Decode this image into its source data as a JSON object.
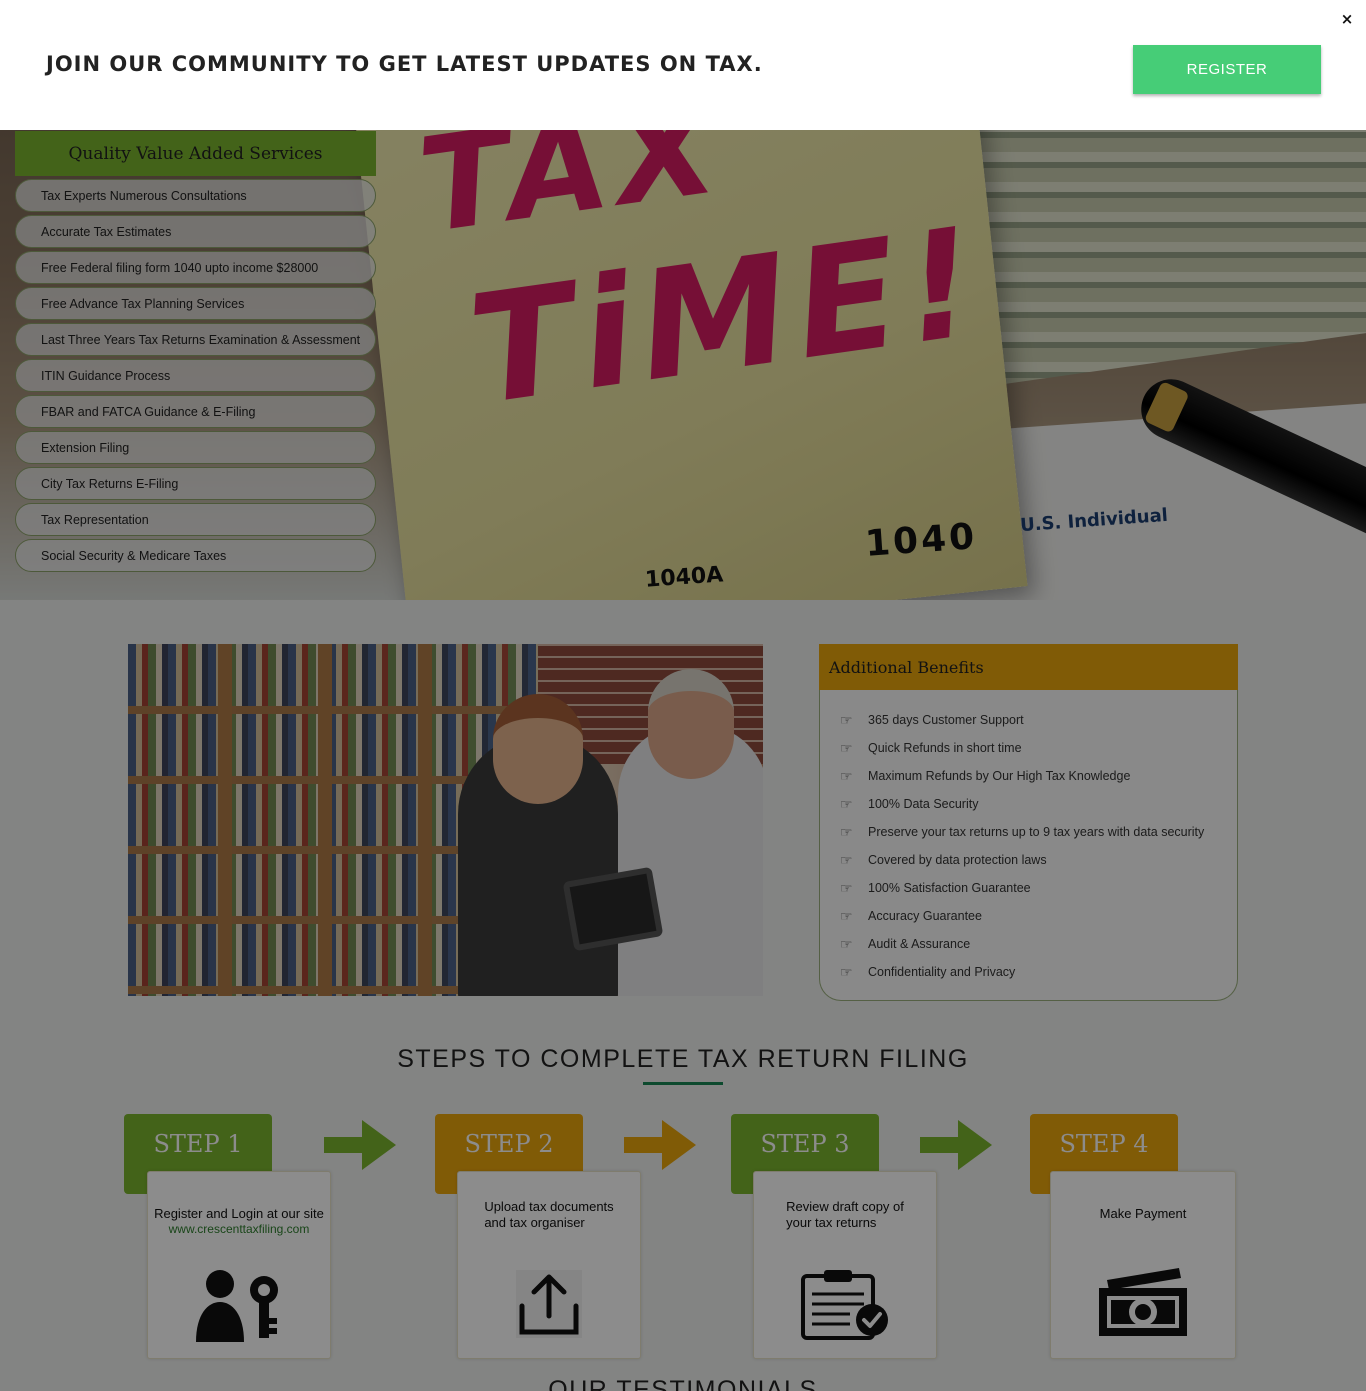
{
  "popup": {
    "message": "JOIN OUR COMMUNITY TO GET LATEST UPDATES ON TAX.",
    "register_label": "REGISTER",
    "close_label": "×"
  },
  "hero": {
    "note_line1": "TAX",
    "note_line2": "TiME!",
    "form_number": "1040",
    "form_number_small": "1040A",
    "form_header": "U.S. Individual"
  },
  "services": {
    "title": "Quality Value Added Services",
    "items": [
      "Tax Experts Numerous Consultations",
      "Accurate Tax Estimates",
      "Free Federal filing form 1040 upto income $28000",
      "Free Advance Tax Planning Services",
      "Last Three Years Tax Returns Examination & Assessment",
      "ITIN Guidance Process",
      "FBAR and FATCA Guidance & E-Filing",
      "Extension Filing",
      "City Tax Returns E-Filing",
      "Tax Representation",
      "Social Security & Medicare Taxes"
    ]
  },
  "benefits": {
    "title": "Additional Benefits",
    "icon": "hand-pointing-right-icon",
    "items": [
      "365 days Customer Support",
      "Quick Refunds in short time",
      "Maximum Refunds by Our High Tax Knowledge",
      "100% Data Security",
      "Preserve your tax returns up to 9 tax years with data security",
      "Covered by data protection laws",
      "100% Satisfaction Guarantee",
      "Accuracy Guarantee",
      "Audit & Assurance",
      "Confidentiality and Privacy"
    ]
  },
  "steps": {
    "title": "STEPS TO COMPLETE TAX RETURN FILING",
    "items": [
      {
        "label": "STEP 1",
        "text_line1": "Register and Login at  our site",
        "text_line2": "www.crescenttaxfiling.com",
        "icon": "user-key-icon",
        "color": "#7ab42e"
      },
      {
        "label": "STEP 2",
        "text_line1": "Upload tax documents",
        "text_line2": "and tax organiser",
        "icon": "upload-icon",
        "color": "#eaa60c"
      },
      {
        "label": "STEP 3",
        "text_line1": "Review draft copy of",
        "text_line2": "your tax returns",
        "icon": "clipboard-check-icon",
        "color": "#7ab42e"
      },
      {
        "label": "STEP 4",
        "text_line1": "Make Payment",
        "text_line2": "",
        "icon": "money-icon",
        "color": "#eaa60c"
      }
    ]
  },
  "testimonials": {
    "title": "OUR TESTIMONIALS"
  },
  "colors": {
    "green": "#7ab42e",
    "orange": "#eaa60c",
    "register": "#46cd77",
    "note_ink": "#d81c63"
  }
}
